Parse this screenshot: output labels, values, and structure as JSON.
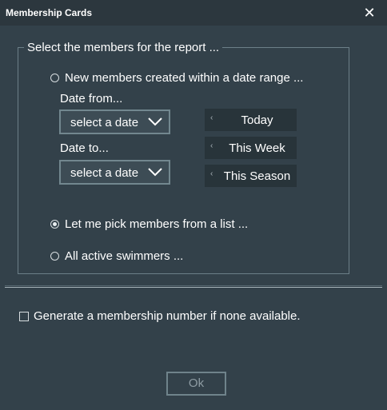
{
  "window": {
    "title": "Membership Cards",
    "close_icon": "close-icon"
  },
  "group": {
    "title": "Select the members for the report ..."
  },
  "options": {
    "date_range": {
      "label": "New members created within a date range ...",
      "selected": false
    },
    "pick_list": {
      "label": "Let me pick members from a list ...",
      "selected": true
    },
    "all_active": {
      "label": "All active swimmers ...",
      "selected": false
    }
  },
  "date_from": {
    "label": "Date from...",
    "value": "select a date"
  },
  "date_to": {
    "label": "Date to...",
    "value": "select a date"
  },
  "quick_buttons": {
    "today": "Today",
    "this_week": "This Week",
    "this_season": "This Season"
  },
  "generate_number": {
    "label": "Generate a membership number if none available.",
    "checked": false
  },
  "ok_button": {
    "label": "Ok",
    "enabled": false
  },
  "colors": {
    "background": "#33414a",
    "titlebar": "#2c373e",
    "quick_button": "#28343a",
    "border": "#72878f"
  }
}
